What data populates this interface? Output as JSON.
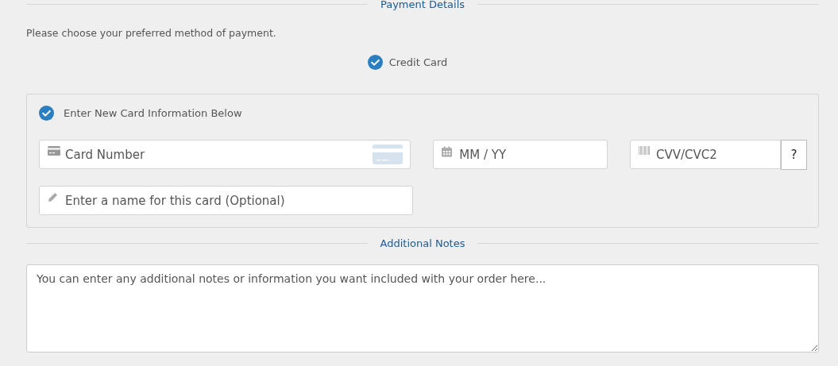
{
  "payment_section": {
    "title": "Payment Details",
    "instruction": "Please choose your preferred method of payment.",
    "methods": [
      {
        "label": "Credit Card",
        "selected": true
      }
    ]
  },
  "card_panel": {
    "new_card": {
      "label": "Enter New Card Information Below",
      "checked": true
    },
    "fields": [
      {
        "kind": "card-number",
        "placeholder": "Card Number"
      },
      {
        "kind": "expiry",
        "placeholder": "MM / YY"
      },
      {
        "kind": "cvv",
        "placeholder": "CVV/CVC2",
        "help": "?"
      },
      {
        "kind": "card-name",
        "placeholder": "Enter a name for this card (Optional)"
      }
    ]
  },
  "notes_section": {
    "title": "Additional Notes",
    "placeholder": "You can enter any additional notes or information you want included with your order here..."
  }
}
